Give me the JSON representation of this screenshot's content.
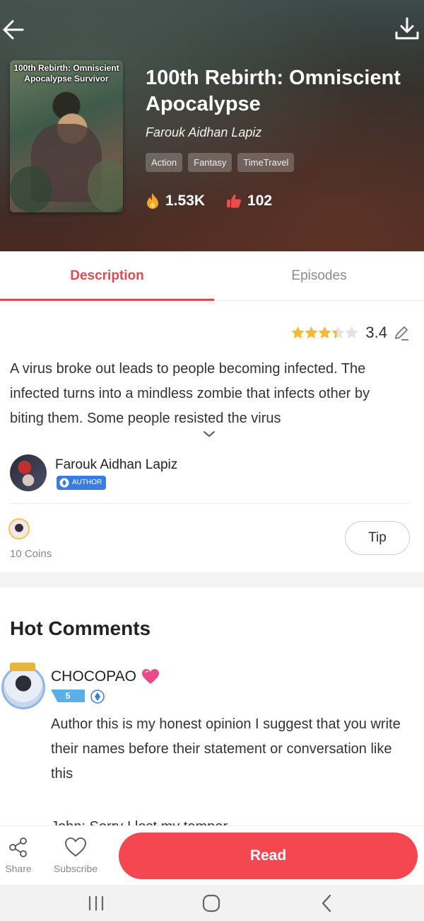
{
  "header": {
    "cover_title": "100th Rebirth: Omniscient Apocalypse Survivor",
    "title": "100th Rebirth: Omniscient Apocalypse",
    "author": "Farouk Aidhan Lapiz",
    "tags": [
      "Action",
      "Fantasy",
      "TimeTravel"
    ],
    "views": "1.53K",
    "likes": "102",
    "icons": {
      "back": "arrow-left-icon",
      "download": "download-icon",
      "views": "fire-icon",
      "likes": "thumbs-up-icon"
    }
  },
  "tabs": [
    {
      "label": "Description",
      "active": true
    },
    {
      "label": "Episodes",
      "active": false
    }
  ],
  "rating": {
    "value": "3.4",
    "stars": 3.4,
    "icon": "edit-pencil-icon"
  },
  "description": "A virus broke out leads to people becoming infected. The infected turns into a mindless zombie that infects other by biting them. Some people resisted the virus",
  "author_card": {
    "name": "Farouk Aidhan Lapiz",
    "badge": "AUTHOR"
  },
  "tip": {
    "coins": "10 Coins",
    "button": "Tip"
  },
  "comments": {
    "heading": "Hot Comments",
    "items": [
      {
        "user": "CHOCOPAO",
        "level": "5",
        "text": "Author this is my honest opinion I suggest that you write their names before their statement or conversation like this",
        "text2": "John: Sorry I lost my temper"
      }
    ]
  },
  "bottom": {
    "share": "Share",
    "subscribe": "Subscribe",
    "read": "Read"
  },
  "colors": {
    "accent": "#f5474f",
    "tab_active": "#e04b52",
    "star": "#f5b932",
    "author_badge": "#3b7ce0"
  }
}
